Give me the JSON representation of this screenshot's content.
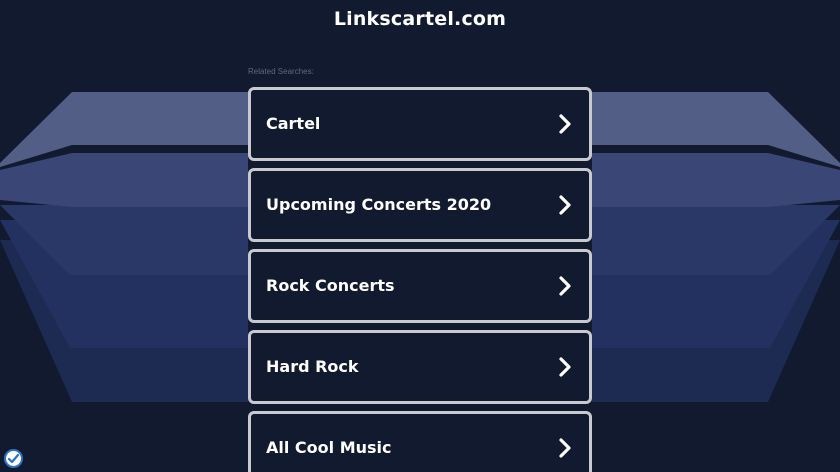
{
  "header": {
    "domain": "Linkscartel.com"
  },
  "related": {
    "label": "Related Searches:",
    "items": [
      {
        "label": "Cartel",
        "icon": "chevron-right-icon"
      },
      {
        "label": "Upcoming Concerts 2020",
        "icon": "chevron-right-icon"
      },
      {
        "label": "Rock Concerts",
        "icon": "chevron-right-icon"
      },
      {
        "label": "Hard Rock",
        "icon": "chevron-right-icon"
      },
      {
        "label": "All Cool Music",
        "icon": "chevron-right-icon"
      }
    ]
  },
  "footer": {
    "badge_icon": "privacy-checkmark-icon"
  },
  "colors": {
    "background": "#121a30",
    "box_border": "#c8cad0",
    "text": "#ffffff",
    "muted_text": "#5f6780"
  }
}
